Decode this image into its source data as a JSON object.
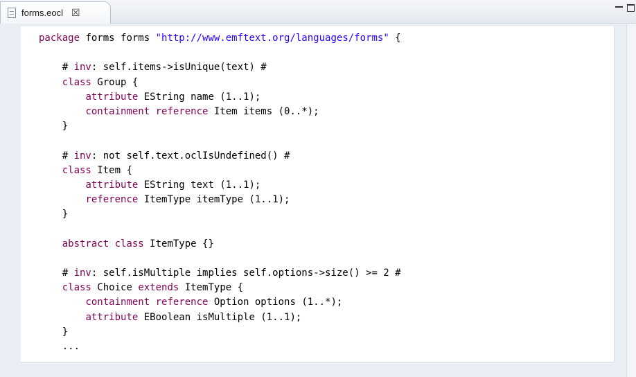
{
  "tab": {
    "title": "forms.eocl",
    "close_glyph": "☒",
    "icon": "file-icon"
  },
  "window_controls": {
    "minimize": "minimize-icon",
    "maximize": "maximize-icon"
  },
  "colors": {
    "keyword": "#7f0055",
    "string": "#2a00ff",
    "text": "#000000"
  },
  "code": {
    "lines": [
      [
        {
          "t": "package",
          "c": "kw"
        },
        {
          "t": " forms forms "
        },
        {
          "t": "\"http://www.emftext.org/languages/forms\"",
          "c": "str"
        },
        {
          "t": " {"
        }
      ],
      [],
      [
        {
          "t": "    # "
        },
        {
          "t": "inv",
          "c": "kw"
        },
        {
          "t": ": self.items->isUnique(text) #"
        }
      ],
      [
        {
          "t": "    "
        },
        {
          "t": "class",
          "c": "kw"
        },
        {
          "t": " Group {"
        }
      ],
      [
        {
          "t": "        "
        },
        {
          "t": "attribute",
          "c": "kw"
        },
        {
          "t": " EString name (1..1);"
        }
      ],
      [
        {
          "t": "        "
        },
        {
          "t": "containment reference",
          "c": "kw"
        },
        {
          "t": " Item items (0..*);"
        }
      ],
      [
        {
          "t": "    }"
        }
      ],
      [],
      [
        {
          "t": "    # "
        },
        {
          "t": "inv",
          "c": "kw"
        },
        {
          "t": ": not self.text.oclIsUndefined() #"
        }
      ],
      [
        {
          "t": "    "
        },
        {
          "t": "class",
          "c": "kw"
        },
        {
          "t": " Item {"
        }
      ],
      [
        {
          "t": "        "
        },
        {
          "t": "attribute",
          "c": "kw"
        },
        {
          "t": " EString text (1..1);"
        }
      ],
      [
        {
          "t": "        "
        },
        {
          "t": "reference",
          "c": "kw"
        },
        {
          "t": " ItemType itemType (1..1);"
        }
      ],
      [
        {
          "t": "    }"
        }
      ],
      [],
      [
        {
          "t": "    "
        },
        {
          "t": "abstract class",
          "c": "kw"
        },
        {
          "t": " ItemType {}"
        }
      ],
      [],
      [
        {
          "t": "    # "
        },
        {
          "t": "inv",
          "c": "kw"
        },
        {
          "t": ": self.isMultiple implies self.options->size() >= 2 #"
        }
      ],
      [
        {
          "t": "    "
        },
        {
          "t": "class",
          "c": "kw"
        },
        {
          "t": " Choice "
        },
        {
          "t": "extends",
          "c": "kw"
        },
        {
          "t": " ItemType {"
        }
      ],
      [
        {
          "t": "        "
        },
        {
          "t": "containment reference",
          "c": "kw"
        },
        {
          "t": " Option options (1..*);"
        }
      ],
      [
        {
          "t": "        "
        },
        {
          "t": "attribute",
          "c": "kw"
        },
        {
          "t": " EBoolean isMultiple (1..1);"
        }
      ],
      [
        {
          "t": "    }"
        }
      ],
      [
        {
          "t": "    ..."
        }
      ]
    ]
  }
}
